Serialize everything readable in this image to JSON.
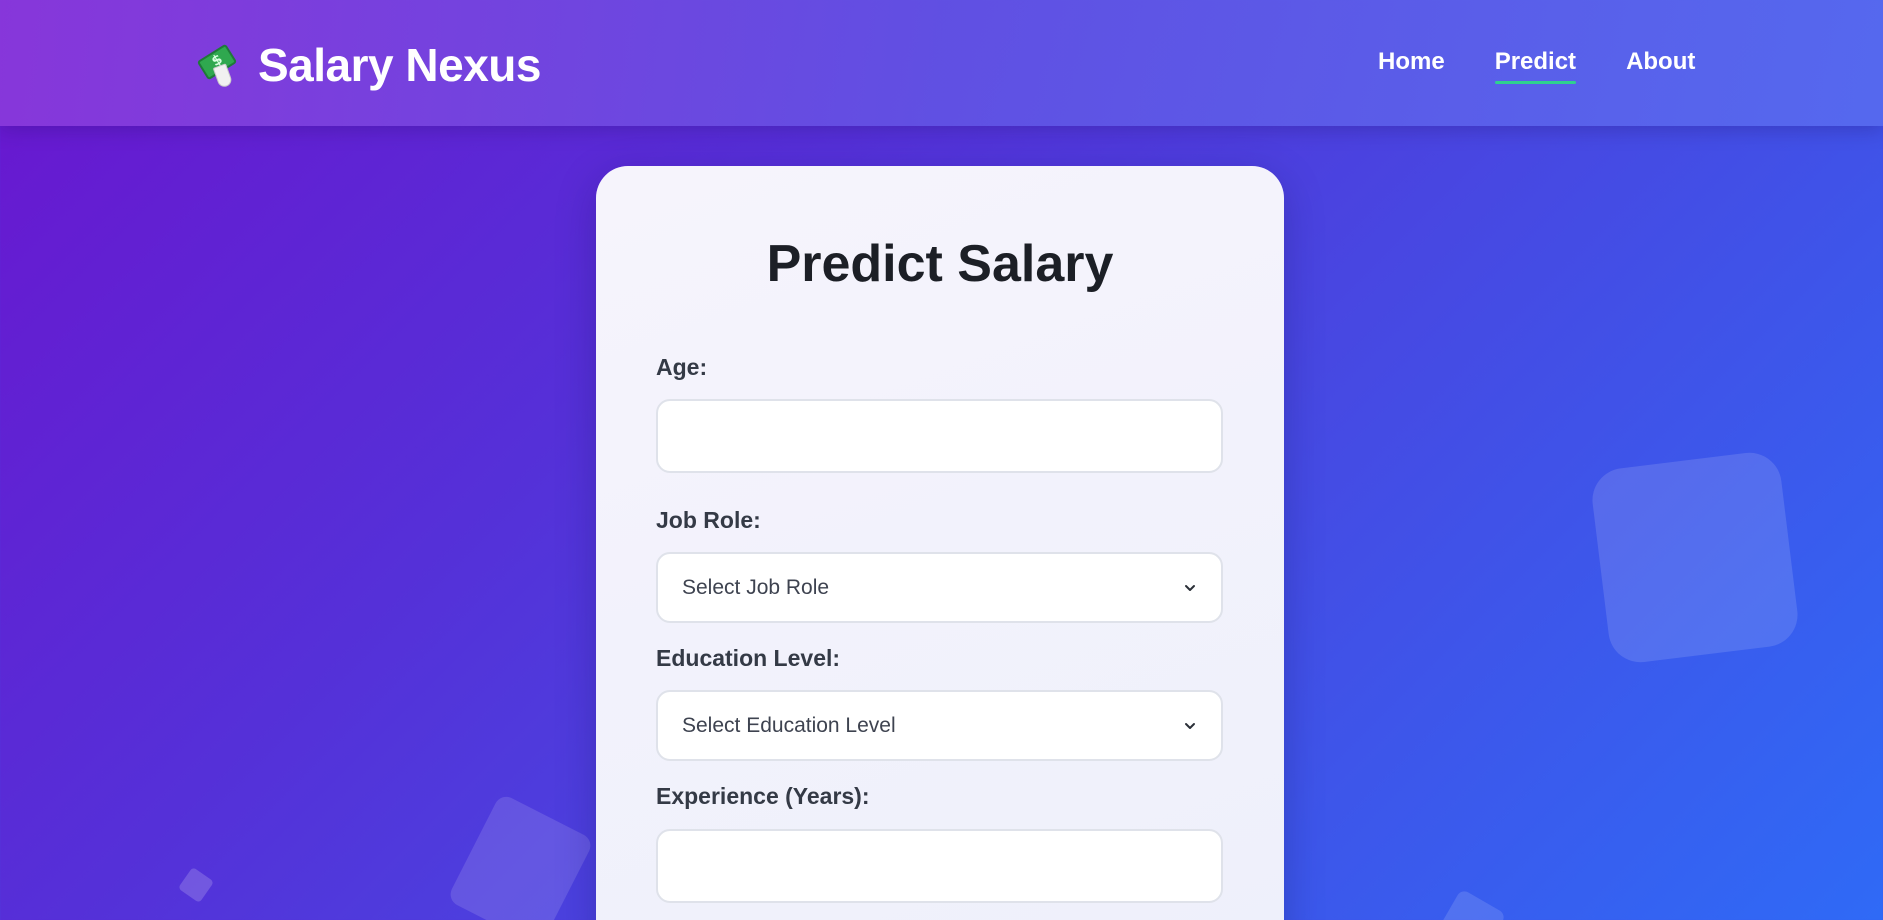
{
  "header": {
    "brand_title": "Salary Nexus",
    "nav": [
      {
        "label": "Home",
        "active": false
      },
      {
        "label": "Predict",
        "active": true
      },
      {
        "label": "About",
        "active": false
      }
    ]
  },
  "form": {
    "title": "Predict Salary",
    "age": {
      "label": "Age:",
      "value": "",
      "placeholder": ""
    },
    "job_role": {
      "label": "Job Role:",
      "selected": "Select Job Role"
    },
    "education": {
      "label": "Education Level:",
      "selected": "Select Education Level"
    },
    "experience": {
      "label": "Experience (Years):",
      "value": "",
      "placeholder": ""
    }
  },
  "icons": {
    "brand": "money-with-wings-icon",
    "select_arrow": "chevron-down-icon"
  },
  "colors": {
    "accent_underline": "#2fd18f",
    "background_start": "#6a16cf",
    "background_end": "#2f6af6"
  }
}
